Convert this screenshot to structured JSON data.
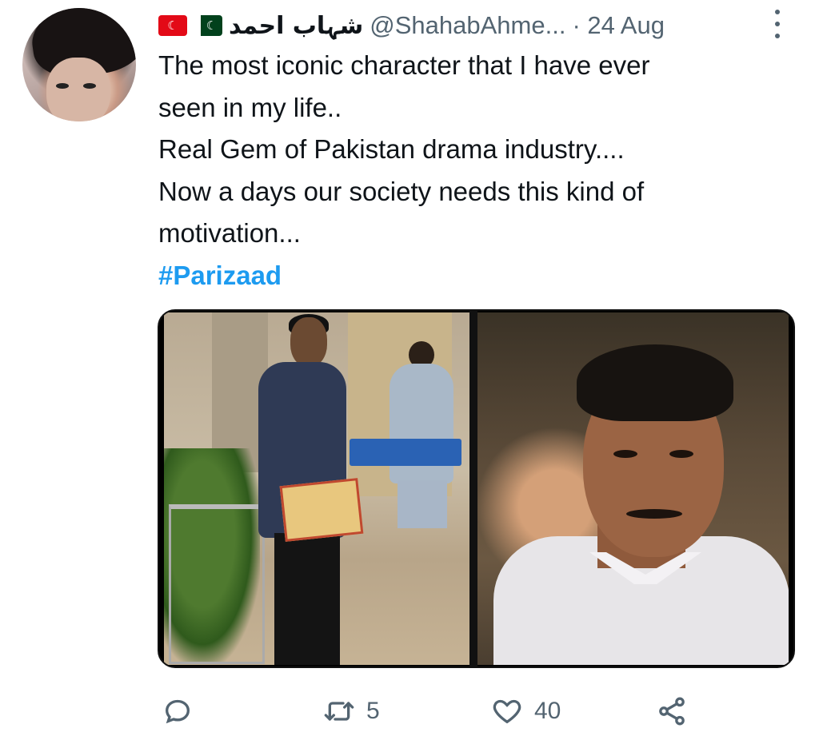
{
  "tweet": {
    "author_name": "شہاب احمد",
    "handle": "@ShahabAhme...",
    "time": "· 24 Aug",
    "flags": [
      "turkey-flag",
      "pakistan-flag"
    ],
    "lines": [
      "The most iconic character that I have ever",
      "seen in my life..",
      "Real Gem of Pakistan drama industry....",
      "Now a days our society needs this kind of",
      "motivation..."
    ],
    "hashtag": "#Parizaad",
    "retweets": "5",
    "likes": "40"
  },
  "colors": {
    "accent": "#1d9bf0",
    "secondary_text": "#536471",
    "text": "#0f1419"
  },
  "icons": {
    "reply": "speech-bubble-icon",
    "retweet": "retweet-icon",
    "like": "heart-icon",
    "share": "share-icon",
    "more": "more-vertical-icon"
  }
}
